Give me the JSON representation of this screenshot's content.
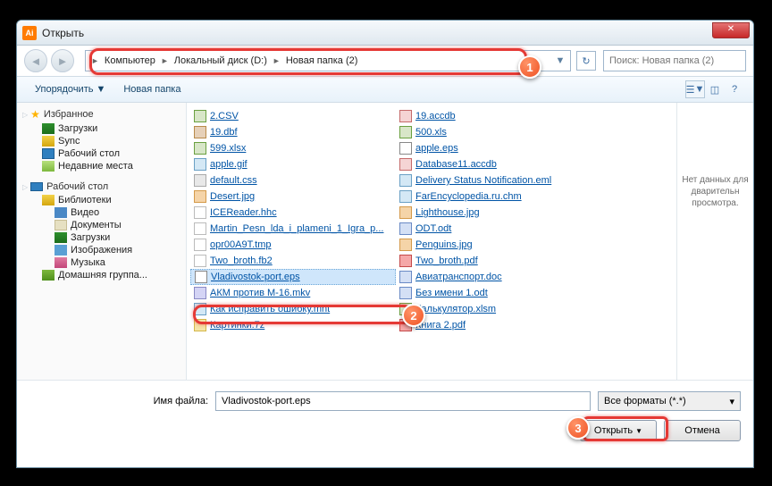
{
  "window": {
    "title": "Открыть",
    "close_label": "✕"
  },
  "nav": {
    "back": "◄",
    "fwd": "►"
  },
  "breadcrumb": {
    "items": [
      "Компьютер",
      "Локальный диск (D:)",
      "Новая папка (2)"
    ],
    "arrow": "►",
    "dropdown": "▼",
    "refresh": "↻"
  },
  "search": {
    "placeholder": "Поиск: Новая папка (2)"
  },
  "toolbar": {
    "organize": "Упорядочить",
    "organize_arrow": "▼",
    "newfolder": "Новая папка",
    "view_arrow": "▼",
    "help": "?"
  },
  "sidebar": {
    "favorites": {
      "label": "Избранное",
      "items": [
        "Загрузки",
        "Sync",
        "Рабочий стол",
        "Недавние места"
      ]
    },
    "desktop": {
      "label": "Рабочий стол"
    },
    "libraries": {
      "label": "Библиотеки",
      "items": [
        "Видео",
        "Документы",
        "Загрузки",
        "Изображения",
        "Музыка"
      ]
    },
    "homegroup": {
      "label": "Домашняя группа..."
    }
  },
  "files": {
    "col1": [
      "2.CSV",
      "19.dbf",
      "599.xlsx",
      "apple.gif",
      "default.css",
      "Desert.jpg",
      "ICEReader.hhc",
      "Martin_Pesn_lda_i_plameni_1_Igra_p...",
      "opr00A9T.tmp",
      "Two_broth.fb2",
      "Vladivostok-port.eps",
      "АКМ против М-16.mkv",
      "Как исправить ошибку.mht",
      "Картинки.7z"
    ],
    "col2": [
      "19.accdb",
      "500.xls",
      "apple.eps",
      "Database11.accdb",
      "Delivery Status Notification.eml",
      "FarEncyclopedia.ru.chm",
      "Lighthouse.jpg",
      "ODT.odt",
      "Penguins.jpg",
      "Two_broth.pdf",
      "Авиатранспорт.doc",
      "Без имени 1.odt",
      "Калькулятор.xlsm",
      "Книга 2.pdf"
    ],
    "selected_index": 10
  },
  "preview": {
    "text": "Нет данных для дварительн просмотра."
  },
  "bottom": {
    "filename_label": "Имя файла:",
    "filename_value": "Vladivostok-port.eps",
    "filetype_label": "Все форматы (*.*)",
    "open_label": "Открыть",
    "cancel_label": "Отмена"
  },
  "badges": {
    "b1": "1",
    "b2": "2",
    "b3": "3"
  }
}
